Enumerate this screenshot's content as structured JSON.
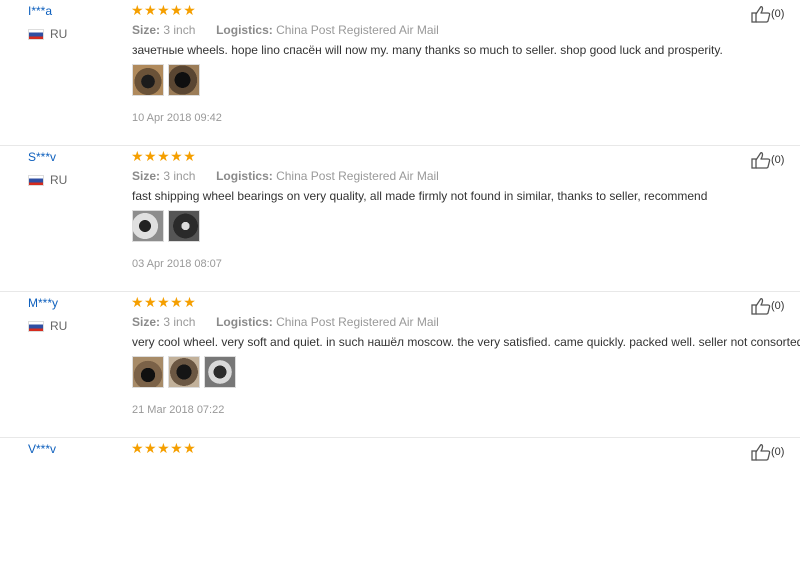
{
  "reviews": [
    {
      "user": "I***a",
      "country": "RU",
      "stars": "★★★★★",
      "size_label": "Size:",
      "size_value": "3 inch",
      "logistics_label": "Logistics:",
      "logistics_value": "China Post Registered Air Mail",
      "text": "зачетные wheels. hope lino спасён will now my. many thanks so much to seller. shop good luck and prosperity.",
      "date": "10 Apr 2018 09:42",
      "helpful": "(0)",
      "photo_count": 2
    },
    {
      "user": "S***v",
      "country": "RU",
      "stars": "★★★★★",
      "size_label": "Size:",
      "size_value": "3 inch",
      "logistics_label": "Logistics:",
      "logistics_value": "China Post Registered Air Mail",
      "text": "fast shipping wheel bearings on very quality, all made firmly not found in similar, thanks to seller, recommend",
      "date": "03 Apr 2018 08:07",
      "helpful": "(0)",
      "photo_count": 2
    },
    {
      "user": "M***y",
      "country": "RU",
      "stars": "★★★★★",
      "size_label": "Size:",
      "size_value": "3 inch",
      "logistics_label": "Logistics:",
      "logistics_value": "China Post Registered Air Mail",
      "text": "very cool wheel. very soft and quiet. in such нашёл moscow. the very satisfied. came quickly. packed well. seller not consorted.",
      "date": "21 Mar 2018 07:22",
      "helpful": "(0)",
      "photo_count": 3
    },
    {
      "user": "V***v",
      "stars": "★★★★★",
      "helpful": "(0)"
    }
  ],
  "colors": {
    "star": "#f59f00",
    "user": "#0d5fbd",
    "meta": "#999999"
  },
  "icons": {
    "flag": "russia-flag-icon",
    "helpful": "thumbs-up-icon",
    "star": "star-icon"
  }
}
